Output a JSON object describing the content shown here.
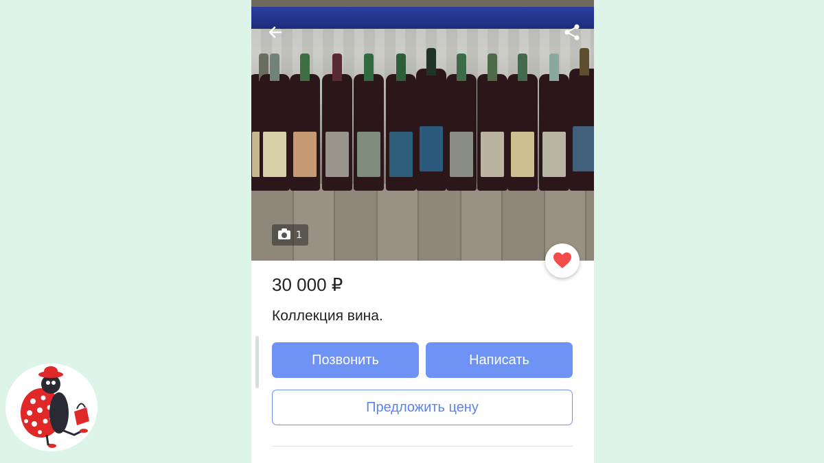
{
  "listing": {
    "price": "30 000 ₽",
    "title": "Коллекция вина.",
    "photo_count": "1"
  },
  "actions": {
    "call_label": "Позвонить",
    "write_label": "Написать",
    "offer_label": "Предложить цену"
  },
  "icons": {
    "back": "arrow-left-icon",
    "share": "share-icon",
    "favorite": "heart-icon",
    "camera": "camera-icon"
  },
  "colors": {
    "background": "#dcf5e8",
    "accent": "#6f93f5",
    "favorite": "#f44b4b"
  }
}
